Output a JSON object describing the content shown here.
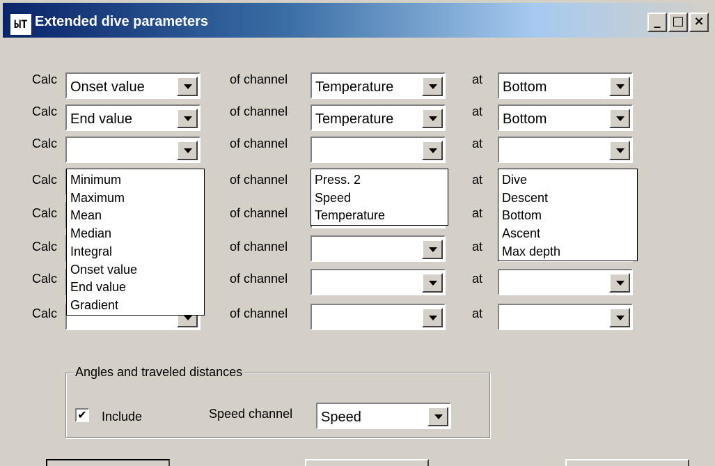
{
  "window": {
    "title": "Extended dive parameters",
    "icon_text": "ЫТ",
    "minimize_glyph": "_",
    "maximize_glyph": "□",
    "close_glyph": "×"
  },
  "labels": {
    "calc": "Calc",
    "of_channel": "of channel",
    "at": "at"
  },
  "rows": [
    {
      "calc": "Onset value",
      "channel": "Temperature",
      "at": "Bottom"
    },
    {
      "calc": "End value",
      "channel": "Temperature",
      "at": "Bottom"
    },
    {
      "calc": "",
      "channel": "",
      "at": ""
    },
    {
      "calc": "",
      "channel": "",
      "at": ""
    },
    {
      "calc": "",
      "channel": "",
      "at": ""
    },
    {
      "calc": "",
      "channel": "",
      "at": ""
    },
    {
      "calc": "",
      "channel": "",
      "at": ""
    },
    {
      "calc": "",
      "channel": "",
      "at": ""
    }
  ],
  "dropdowns": {
    "calc_options": [
      "Minimum",
      "Maximum",
      "Mean",
      "Median",
      "Integral",
      "Onset value",
      "End value",
      "Gradient"
    ],
    "channel_options": [
      "Press. 2",
      "Speed",
      "Temperature"
    ],
    "at_options": [
      "Dive",
      "Descent",
      "Bottom",
      "Ascent",
      "Max depth"
    ]
  },
  "angles_group": {
    "title": "Angles and traveled distances",
    "include_label": "Include",
    "include_checked": true,
    "check_glyph": "✔",
    "speed_channel_label": "Speed channel",
    "speed_channel_value": "Speed"
  }
}
